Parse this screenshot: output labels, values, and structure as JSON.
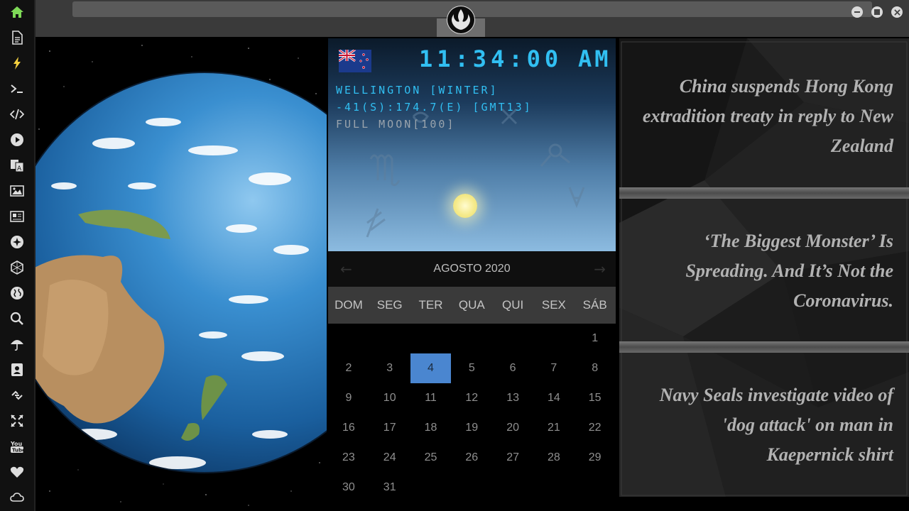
{
  "sidebar": {
    "items": [
      {
        "icon": "home-icon",
        "active": true
      },
      {
        "icon": "document-icon"
      },
      {
        "icon": "lightning-icon"
      },
      {
        "icon": "terminal-icon"
      },
      {
        "icon": "code-icon"
      },
      {
        "icon": "play-icon"
      },
      {
        "icon": "translate-icon"
      },
      {
        "icon": "image-icon"
      },
      {
        "icon": "newspaper-icon"
      },
      {
        "icon": "settings-badge-icon"
      },
      {
        "icon": "hexagon-icon"
      },
      {
        "icon": "globe-icon"
      },
      {
        "icon": "search-icon"
      },
      {
        "icon": "umbrella-icon"
      },
      {
        "icon": "contact-card-icon"
      },
      {
        "icon": "chain-link-icon"
      },
      {
        "icon": "expand-arrows-icon"
      },
      {
        "icon": "youtube-icon"
      },
      {
        "icon": "heart-icon"
      },
      {
        "icon": "cloud-icon"
      }
    ],
    "accent": "#7ed957"
  },
  "clock": {
    "time": "11:34:00",
    "ampm": "AM",
    "city_line": "WELLINGTON [WINTER]",
    "coords_line": "-41(S):174.7(E) [GMT13]",
    "moon_line": "FULL MOON[100]",
    "flag": "new-zealand-flag",
    "color": "#31bff2"
  },
  "calendar": {
    "title": "AGOSTO 2020",
    "days_of_week": [
      "DOM",
      "SEG",
      "TER",
      "QUA",
      "QUI",
      "SEX",
      "SÁB"
    ],
    "weeks": [
      [
        "",
        "",
        "",
        "",
        "",
        "",
        "1"
      ],
      [
        "2",
        "3",
        "4",
        "5",
        "6",
        "7",
        "8"
      ],
      [
        "9",
        "10",
        "11",
        "12",
        "13",
        "14",
        "15"
      ],
      [
        "16",
        "17",
        "18",
        "19",
        "20",
        "21",
        "22"
      ],
      [
        "23",
        "24",
        "25",
        "26",
        "27",
        "28",
        "29"
      ],
      [
        "30",
        "31",
        "",
        "",
        "",
        "",
        ""
      ]
    ],
    "today": "4",
    "today_color": "#4a86d0"
  },
  "news": {
    "items": [
      "China suspends Hong Kong extradition treaty in reply to New Zealand",
      "‘The Biggest Monster’ Is Spreading. And It’s Not the Coronavirus.",
      "Navy Seals investigate video of 'dog attack' on man in Kaepernick shirt"
    ]
  }
}
